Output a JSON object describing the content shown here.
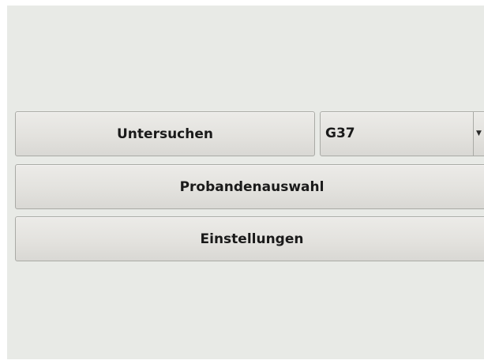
{
  "buttons": {
    "untersuchen": "Untersuchen",
    "probandenauswahl": "Probandenauswahl",
    "einstellungen": "Einstellungen"
  },
  "test_select": {
    "selected": "G37",
    "icon": "chevron-down-icon"
  }
}
